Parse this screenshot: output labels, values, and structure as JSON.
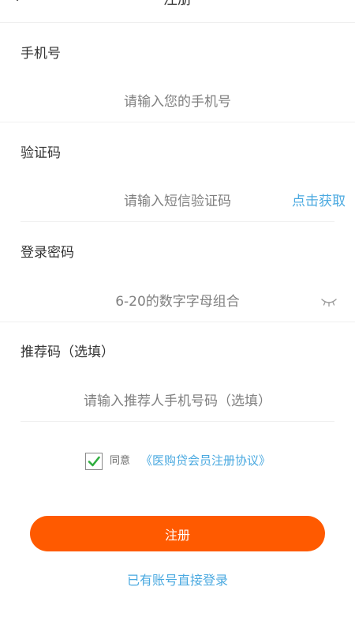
{
  "header": {
    "title": "注册"
  },
  "form": {
    "phone": {
      "label": "手机号",
      "placeholder": "请输入您的手机号"
    },
    "code": {
      "label": "验证码",
      "placeholder": "请输入短信验证码",
      "get_code_label": "点击获取"
    },
    "password": {
      "label": "登录密码",
      "placeholder": "6-20的数字字母组合"
    },
    "referral": {
      "label": "推荐码（选填）",
      "placeholder": "请输入推荐人手机号码（选填）"
    }
  },
  "agreement": {
    "checked": true,
    "agree_text": "同意",
    "link_text": "《医购贷会员注册协议》"
  },
  "actions": {
    "register_label": "注册",
    "login_link": "已有账号直接登录"
  },
  "icons": {
    "back": "chevron-left-icon",
    "password_toggle": "eye-closed-icon",
    "checkbox": "checkmark-icon"
  },
  "colors": {
    "primary": "#ff5a00",
    "link": "#4aa9e0",
    "check": "#2fae3f",
    "text": "#333333",
    "placeholder": "#808080"
  }
}
